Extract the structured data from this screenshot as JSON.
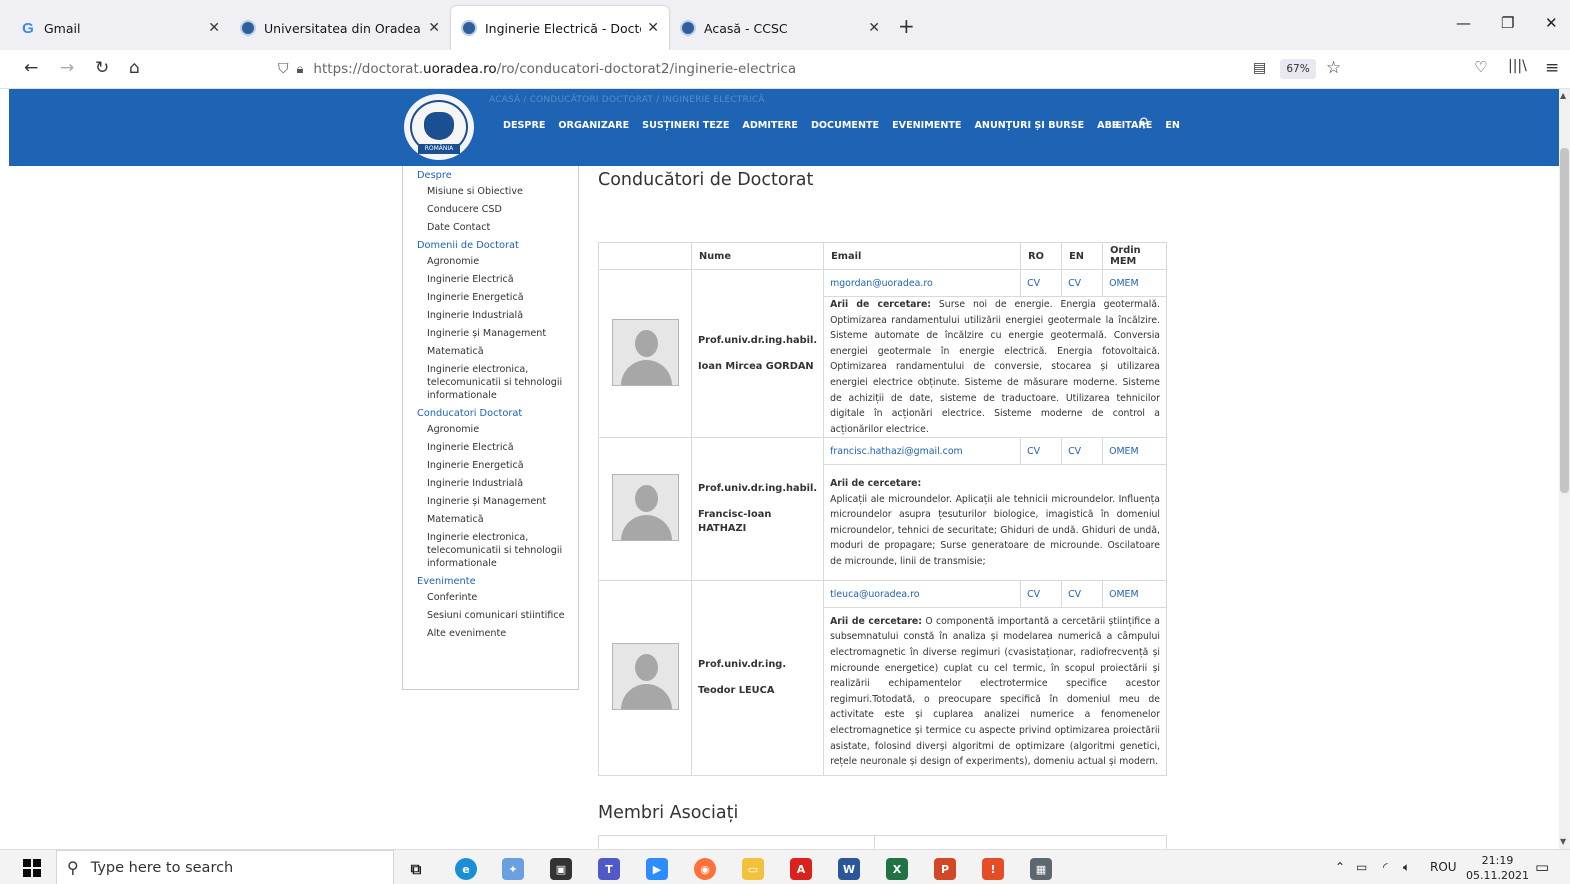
{
  "browser": {
    "tabs": [
      {
        "title": "Gmail",
        "favicon": "gmail-icon",
        "active": false
      },
      {
        "title": "Universitatea din Oradea | Unive",
        "favicon": "university-seal-icon",
        "active": false
      },
      {
        "title": "Inginerie Electrică - Doctorat Ur",
        "favicon": "university-seal-icon",
        "active": true
      },
      {
        "title": "Acasă - CCSC",
        "favicon": "university-seal-icon",
        "active": false
      }
    ],
    "url_prefix": "https://doctorat.",
    "url_domain": "uoradea.ro",
    "url_path": "/ro/conducatori-doctorat2/inginerie-electrica",
    "zoom": "67%"
  },
  "site": {
    "breadcrumb_faded": "ACASĂ  /  CONDUCĂTORI DOCTORAT  /  INGINERIE ELECTRICĂ",
    "logo_ribbon": "ROMÂNIA",
    "menu": [
      "DESPRE",
      "ORGANIZARE",
      "SUSȚINERI TEZE",
      "ADMITERE",
      "DOCUMENTE",
      "EVENIMENTE",
      "ANUNȚURI ȘI BURSE",
      "ABILITARE",
      "EN"
    ],
    "brand_color": "#1f63b5"
  },
  "sidebar": {
    "sections": [
      {
        "title": "Despre",
        "items": [
          "Misiune si Obiective",
          "Conducere CSD",
          "Date Contact"
        ]
      },
      {
        "title": "Domenii de Doctorat",
        "items": [
          "Agronomie",
          "Inginerie Electrică",
          "Inginerie Energetică",
          "Inginerie Industrială",
          "Inginerie și Management",
          "Matematică",
          "Inginerie electronica, telecomunicatii si tehnologii informationale"
        ]
      },
      {
        "title": "Conducatori Doctorat",
        "items": [
          "Agronomie",
          "Inginerie Electrică",
          "Inginerie Energetică",
          "Inginerie Industrială",
          "Inginerie și Management",
          "Matematică",
          "Inginerie electronica, telecomunicatii si tehnologii informationale"
        ]
      },
      {
        "title": "Evenimente",
        "items": [
          "Conferinte",
          "Sesiuni comunicari stiintifice",
          "Alte evenimente"
        ]
      }
    ]
  },
  "main": {
    "title": "Conducători de Doctorat",
    "table_headers": [
      "",
      "Nume",
      "Email",
      "RO",
      "EN",
      "Ordin MEM"
    ],
    "research_label": "Arii de cercetare:",
    "rows": [
      {
        "name_line1": "Prof.univ.dr.ing.habil.",
        "name_line2": "Ioan Mircea GORDAN",
        "email": "mgordan@uoradea.ro",
        "ro": "CV",
        "en": "CV",
        "mem": "OMEM",
        "research": "Surse noi de energie. Energia geotermală. Optimizarea randamentului utilizării energiei geotermale la încălzire. Sisteme automate de încălzire cu energie geotermală. Conversia energiei geotermale în energie electrică. Energia fotovoltaică. Optimizarea randamentului de conversie, stocarea și utilizarea energiei electrice obținute. Sisteme de măsurare moderne. Sisteme de achiziții de date, sisteme de traductoare. Utilizarea tehnicilor digitale în acționări electrice. Sisteme moderne de control a acționărilor electrice."
      },
      {
        "name_line1": "Prof.univ.dr.ing.habil.",
        "name_line2": "Francisc-Ioan HATHAZI",
        "email": "francisc.hathazi@gmail.com",
        "ro": "CV",
        "en": "CV",
        "mem": "OMEM",
        "research": "Aplicații ale microundelor. Aplicații ale tehnicii microundelor. Influența microundelor asupra țesuturilor biologice, imagistică în domeniul microundelor, tehnici de securitate; Ghiduri de undă. Ghiduri de undă, moduri de propagare; Surse generatoare de microunde. Oscilatoare de microunde, linii de transmisie;"
      },
      {
        "name_line1": "Prof.univ.dr.ing.",
        "name_line2": "Teodor LEUCA",
        "email": "tleuca@uoradea.ro",
        "ro": "CV",
        "en": "CV",
        "mem": "OMEM",
        "research": "O componentă importantă a cercetării științifice a subsemnatului constă în analiza și modelarea numerică a câmpului electromagnetic în diverse regimuri (cvasistaționar, radiofrecvență și microunde energetice) cuplat cu cel termic, în scopul proiectării și realizării echipamentelor electrotermice specifice acestor regimuri.Totodată, o preocupare specifică în domeniul meu de activitate este și cuplarea analizei numerice a fenomenelor electromagnetice și termice cu aspecte privind optimizarea proiectării asistate, folosind diverși algoritmi de optimizare (algoritmi genetici, rețele neuronale și design of experiments), domeniu actual și modern."
      }
    ],
    "membri_title": "Membri Asociați"
  },
  "taskbar": {
    "search_placeholder": "Type here to search",
    "language": "ROU",
    "time": "21:19",
    "date": "05.11.2021"
  }
}
